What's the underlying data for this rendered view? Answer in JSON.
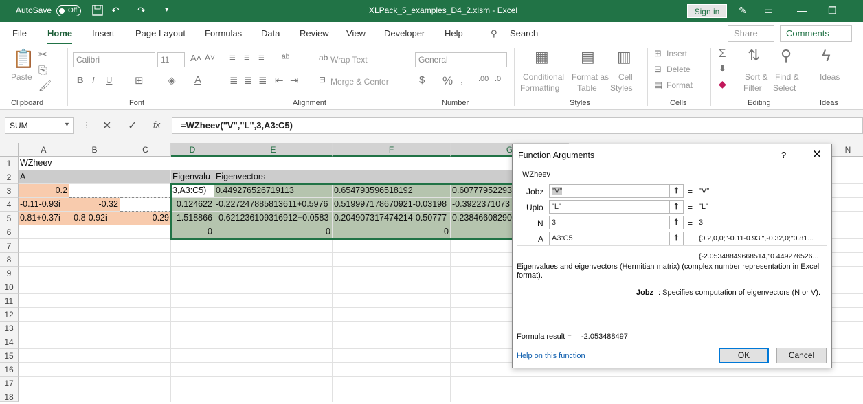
{
  "title_bar": {
    "autosave_label": "AutoSave",
    "autosave_state": "Off",
    "filename": "XLPack_5_examples_D4_2.xlsm  -  Excel",
    "sign_in": "Sign in"
  },
  "menu": {
    "tabs": [
      "File",
      "Home",
      "Insert",
      "Page Layout",
      "Formulas",
      "Data",
      "Review",
      "View",
      "Developer",
      "Help"
    ],
    "active": "Home",
    "search": "Search",
    "share": "Share",
    "comments": "Comments"
  },
  "ribbon": {
    "clipboard": {
      "label": "Clipboard",
      "paste": "Paste"
    },
    "font": {
      "label": "Font",
      "name": "Calibri",
      "size": "11"
    },
    "alignment": {
      "label": "Alignment",
      "wrap_text": "Wrap Text",
      "merge_center": "Merge & Center"
    },
    "number": {
      "label": "Number",
      "format": "General"
    },
    "styles": {
      "label": "Styles",
      "conditional": "Conditional",
      "conditional2": "Formatting",
      "format_as": "Format as",
      "format_as2": "Table",
      "cell": "Cell",
      "cell2": "Styles"
    },
    "cells": {
      "label": "Cells",
      "insert": "Insert",
      "delete": "Delete",
      "format": "Format"
    },
    "editing": {
      "label": "Editing",
      "sort": "Sort &",
      "sort2": "Filter",
      "find": "Find &",
      "find2": "Select"
    },
    "ideas": {
      "label": "Ideas",
      "ideas": "Ideas"
    }
  },
  "formula_bar": {
    "name_box": "SUM",
    "formula": "=WZheev(\"V\",\"L\",3,A3:C5)"
  },
  "sheet": {
    "columns": [
      "A",
      "B",
      "C",
      "D",
      "E",
      "F",
      "G",
      "N"
    ],
    "rows": [
      "1",
      "2",
      "3",
      "4",
      "5",
      "6",
      "7",
      "8",
      "9",
      "10",
      "11",
      "12",
      "13",
      "14",
      "15",
      "16",
      "17",
      "18"
    ],
    "cells": {
      "A1": "WZheev",
      "A2": "A",
      "D2": "Eigenvalu",
      "E2": "Eigenvectors",
      "A3": "0.2",
      "D3": "3,A3:C5)",
      "E3": "0.449276526719113",
      "F3": "0.654793596518192",
      "G3": "0.60777952293",
      "A4": "-0.11-0.93i",
      "B4": "-0.32",
      "D4": "0.124622",
      "E4": "-0.227247885813611+0.5976",
      "F4": "0.519997178670921-0.03198",
      "G4": "-0.3922371073",
      "A5": "0.81+0.37i",
      "B5": "-0.8-0.92i",
      "C5": "-0.29",
      "D5": "1.518866",
      "E5": "-0.621236109316912+0.0583",
      "F5": "0.204907317474214-0.50777",
      "G5": "0.23846608290",
      "D6": "0",
      "E6": "0",
      "F6": "0"
    }
  },
  "dialog": {
    "title": "Function Arguments",
    "help_glyph": "?",
    "function_name": "WZheev",
    "args": [
      {
        "name": "Jobz",
        "value": "\"V\"",
        "result": "\"V\""
      },
      {
        "name": "Uplo",
        "value": "\"L\"",
        "result": "\"L\""
      },
      {
        "name": "N",
        "value": "3",
        "result": "3"
      },
      {
        "name": "A",
        "value": "A3:C5",
        "result": "{0.2,0,0;\"-0.11-0.93i\",-0.32,0;\"0.81..."
      }
    ],
    "equals": "=",
    "overall_result": "{-2.05348849668514,\"0.449276526...",
    "description": "Eigenvalues and eigenvectors (Hermitian matrix) (complex number representation in Excel format).",
    "arg_help_name": "Jobz",
    "arg_help_text": ": Specifies computation of eigenvectors (N or V).",
    "formula_result_label": "Formula result =",
    "formula_result_value": "-2.053488497",
    "help_link": "Help on this function",
    "ok": "OK",
    "cancel": "Cancel"
  }
}
